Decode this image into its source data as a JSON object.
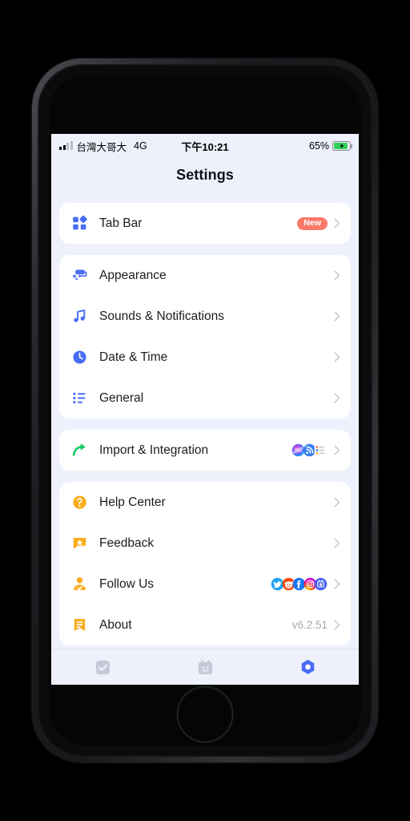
{
  "device": {
    "type": "iphone-8",
    "frame_color": "#2b2d31"
  },
  "statusbar": {
    "carrier": "台灣大哥大",
    "network": "4G",
    "time": "下午10:21",
    "battery_percent": "65%",
    "battery_state": "charging",
    "battery_color": "#30d158"
  },
  "navbar": {
    "title": "Settings"
  },
  "theme": {
    "background": "#eef1fb",
    "card": "#ffffff",
    "accent_blue": "#4a6cf7",
    "accent_amber": "#f9ac18",
    "accent_green": "#17c964",
    "badge": "#fb7a6b",
    "label": "#1b1c21",
    "value": "#a6a9b4",
    "chevron": "#c3c6d0"
  },
  "groups": [
    {
      "id": "group-tab-bar",
      "rows": [
        {
          "label": "Tab Bar",
          "icon": "grid-squares-icon",
          "icon_color": "#4a6cf7",
          "badge": "New",
          "value": "",
          "chevron": true
        }
      ]
    },
    {
      "id": "group-preferences",
      "rows": [
        {
          "label": "Appearance",
          "icon": "paint-roller-icon",
          "icon_color": "#4a6cf7",
          "badge": "",
          "value": "",
          "chevron": true
        },
        {
          "label": "Sounds & Notifications",
          "icon": "music-note-icon",
          "icon_color": "#4a6cf7",
          "badge": "",
          "value": "",
          "chevron": true
        },
        {
          "label": "Date & Time",
          "icon": "clock-icon",
          "icon_color": "#4a6cf7",
          "badge": "",
          "value": "",
          "chevron": true
        },
        {
          "label": "General",
          "icon": "bullet-list-icon",
          "icon_color": "#4a6cf7",
          "badge": "",
          "value": "",
          "chevron": true
        }
      ]
    },
    {
      "id": "group-import",
      "rows": [
        {
          "label": "Import & Integration",
          "icon": "share-arrow-icon",
          "icon_color": "#17c964",
          "badge": "",
          "value": "",
          "mini_icons": [
            "siri-icon",
            "rss-icon",
            "reminders-icon"
          ],
          "chevron": true
        }
      ]
    },
    {
      "id": "group-support",
      "rows": [
        {
          "label": "Help Center",
          "icon": "question-circle-icon",
          "icon_color": "#f9ac18",
          "badge": "",
          "value": "",
          "chevron": true
        },
        {
          "label": "Feedback",
          "icon": "star-bubble-icon",
          "icon_color": "#f9ac18",
          "badge": "",
          "value": "",
          "chevron": true
        },
        {
          "label": "Follow Us",
          "icon": "person-check-icon",
          "icon_color": "#f9ac18",
          "badge": "",
          "value": "",
          "social_icons": [
            "twitter-icon",
            "reddit-icon",
            "facebook-icon",
            "instagram-icon",
            "bilibili-icon"
          ],
          "chevron": true
        },
        {
          "label": "About",
          "icon": "bookmark-lines-icon",
          "icon_color": "#f9ac18",
          "badge": "",
          "value": "v6.2.51",
          "chevron": true
        }
      ]
    }
  ],
  "tabbar": {
    "tabs": [
      {
        "id": "tab-tasks",
        "icon": "checkbox-icon",
        "active": false,
        "color": "#c6cad8"
      },
      {
        "id": "tab-calendar",
        "icon": "calendar-12-icon",
        "active": false,
        "color": "#c6cad8"
      },
      {
        "id": "tab-settings",
        "icon": "gear-hex-icon",
        "active": true,
        "color": "#4a6cf7"
      }
    ]
  }
}
